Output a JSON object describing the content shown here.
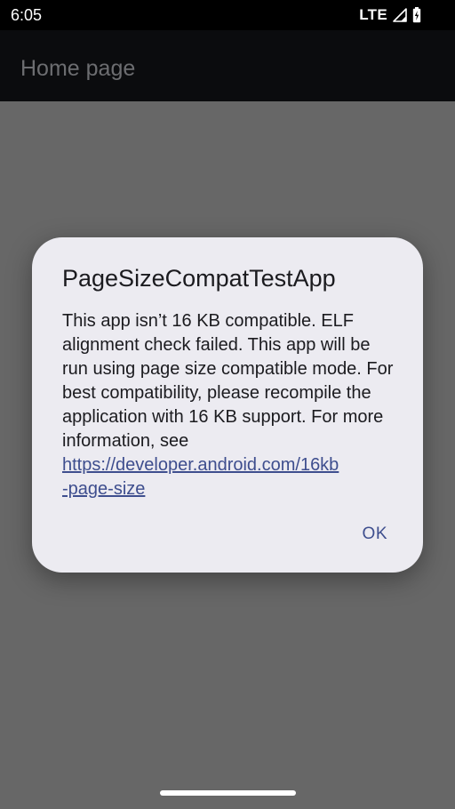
{
  "status_bar": {
    "time": "6:05",
    "network": "LTE",
    "icons": [
      "signal-icon",
      "battery-charging-icon"
    ]
  },
  "app_bar": {
    "title": "Home page"
  },
  "dialog": {
    "title": "PageSizeCompatTestApp",
    "message": "This app isn’t 16 KB compatible. ELF alignment check failed. This app will be run using page size compatible mode. For best compatibility, please recompile the application with 16 KB support. For more information, see",
    "link": "https://developer.android.com/16kb-page-size",
    "link_line1": "https://developer.android.com/16kb",
    "link_line2": "-page-size",
    "ok_label": "OK"
  },
  "colors": {
    "scrim": "#676767",
    "status_bar": "#000000",
    "app_bar": "#0b0c0e",
    "dialog_background": "#ecebf1",
    "accent": "#3e4e8e"
  }
}
